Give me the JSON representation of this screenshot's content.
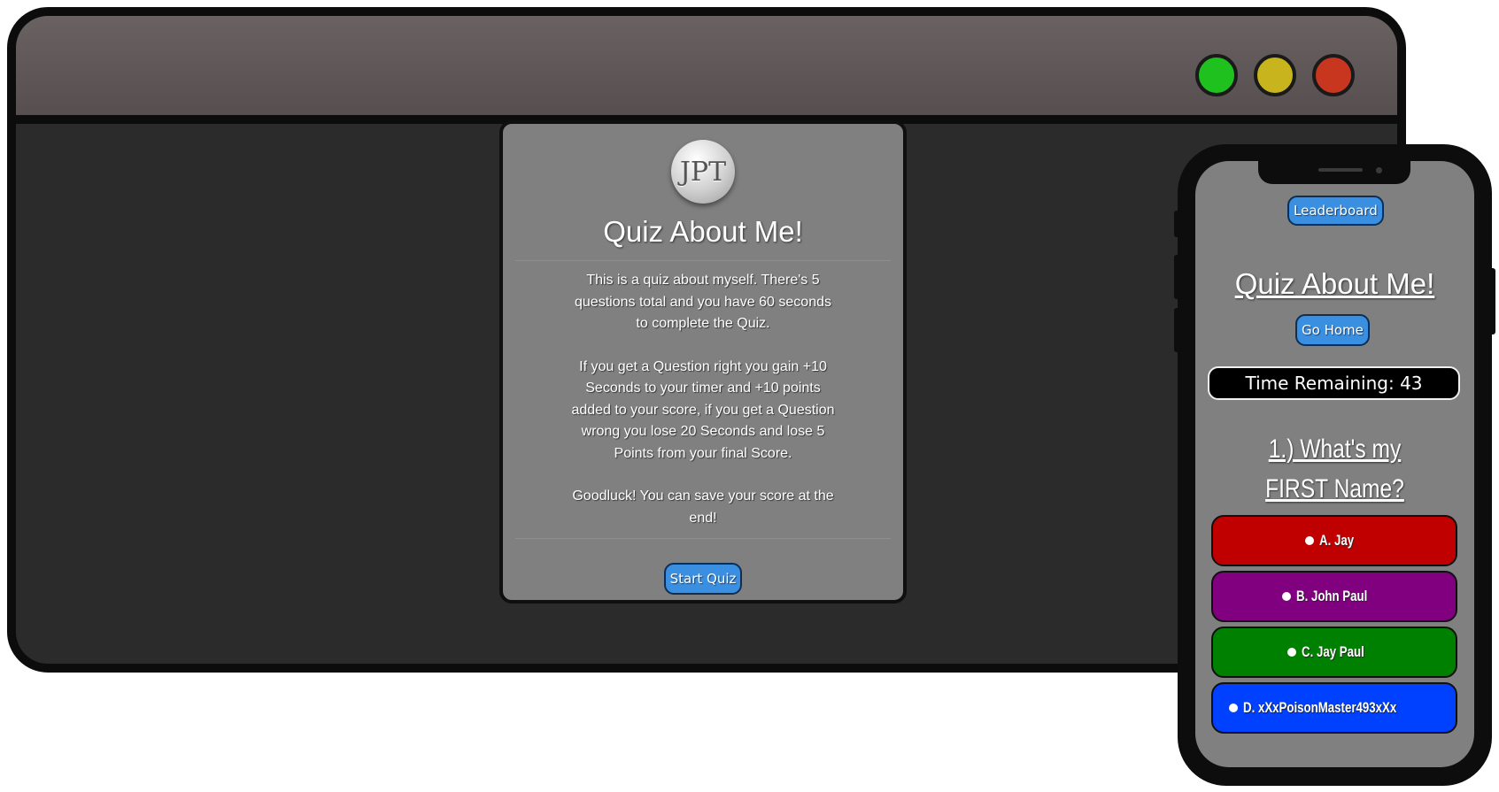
{
  "window_controls": {
    "green_color": "#1fc11f",
    "yellow_color": "#c8b41d",
    "red_color": "#c9361f"
  },
  "desktop_card": {
    "logo_text": "JPT",
    "title": "Quiz About Me!",
    "paragraphs": [
      "This is a quiz about myself. There's 5 questions total and you have 60 seconds to complete the Quiz.",
      "If you get a Question right you gain +10 Seconds to your timer and +10 points added to your score, if you get a Question wrong you lose 20 Seconds and lose 5 Points from your final Score.",
      "Goodluck! You can save your score at the end!"
    ],
    "start_button": "Start Quiz"
  },
  "phone": {
    "leaderboard_button": "Leaderboard",
    "title": "Quiz About Me!",
    "home_button": "Go Home",
    "timer": "Time Remaining: 43",
    "question": "1.) What's my FIRST Name?",
    "answers": [
      {
        "label": "A. Jay",
        "color": "#c00000"
      },
      {
        "label": "B. John Paul",
        "color": "#800080"
      },
      {
        "label": "C. Jay Paul",
        "color": "#008000"
      },
      {
        "label": "D. xXxPoisonMaster493xXx",
        "color": "#0040ff"
      }
    ]
  },
  "colors": {
    "button_blue": "#3b8fe0",
    "card_gray": "#808080",
    "page_dark": "#2b2b2b"
  }
}
